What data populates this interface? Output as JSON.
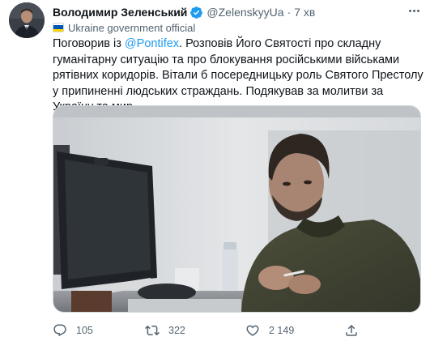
{
  "tweet": {
    "author": {
      "display_name": "Володимир Зеленський",
      "handle": "@ZelenskyyUa",
      "verified": true,
      "avatar_icon": "avatar-photo"
    },
    "separator": "·",
    "time": "7 хв",
    "label": {
      "icon": "ukraine-flag-icon",
      "text": "Ukraine government official"
    },
    "text": {
      "before_mention": "Поговорив із ",
      "mention": "@Pontifex",
      "after_mention": ". Розповів Його Святості про складну гуманітарну ситуацію та про блокування російськими військами рятівних коридорів. Вітали б посередницьку роль Святого Престолу у припиненні людських страждань. Подякував за молитви за Україну та мир."
    },
    "media": {
      "type": "photo"
    },
    "actions": {
      "reply_count": "105",
      "retweet_count": "322",
      "like_count": "2 149"
    }
  },
  "colors": {
    "accent": "#1d9bf0",
    "secondary_text": "#536471",
    "primary_text": "#0f1419",
    "flag_blue": "#0057b7",
    "flag_yellow": "#ffd700"
  }
}
